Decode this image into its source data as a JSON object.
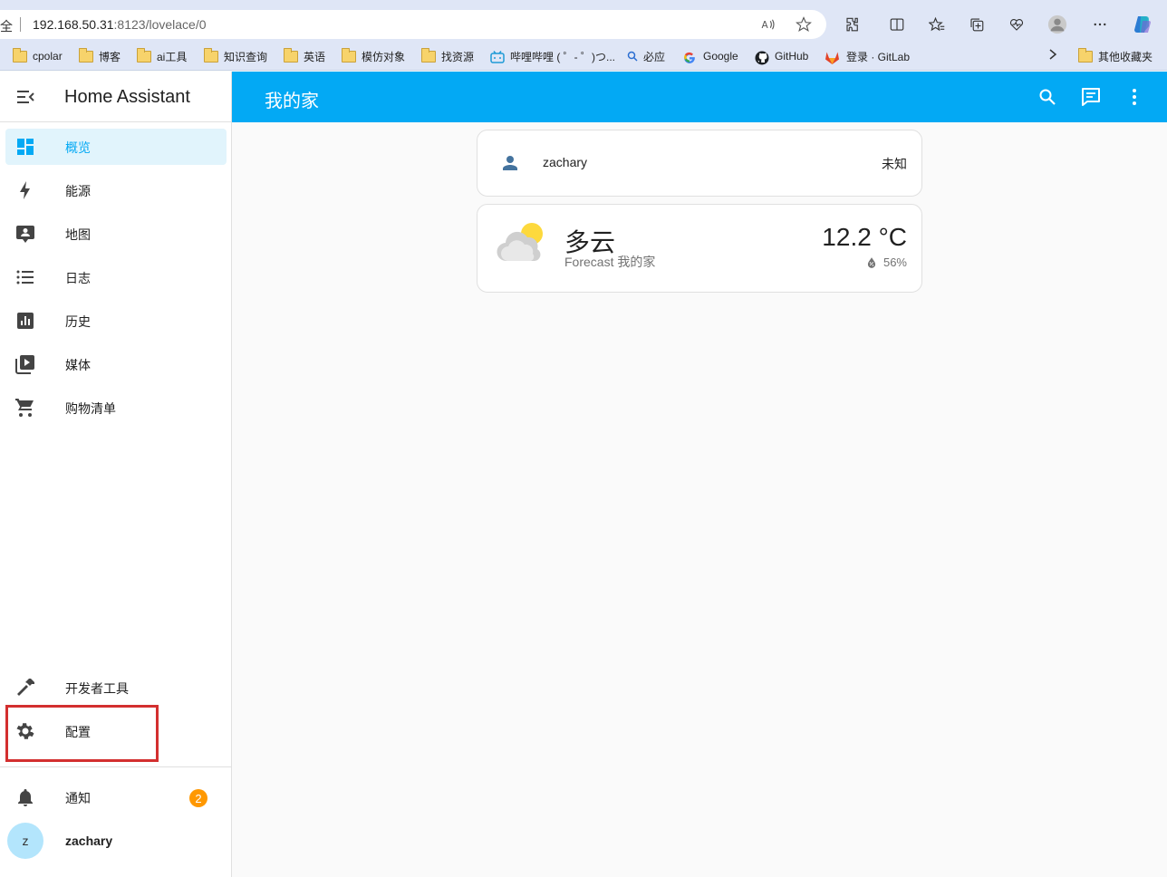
{
  "browser": {
    "address_prefix": "全",
    "url_host": "192.168.50.31",
    "url_path": ":8123/lovelace/0",
    "bookmarks": [
      {
        "label": "cpolar",
        "icon": "folder-icon"
      },
      {
        "label": "博客",
        "icon": "folder-icon"
      },
      {
        "label": "ai工具",
        "icon": "folder-icon"
      },
      {
        "label": "知识查询",
        "icon": "folder-icon"
      },
      {
        "label": "英语",
        "icon": "folder-icon"
      },
      {
        "label": "模仿对象",
        "icon": "folder-icon"
      },
      {
        "label": "找资源",
        "icon": "folder-icon"
      },
      {
        "label": "哔哩哔哩 ( ゜- ゜)つ...",
        "icon": "bilibili-icon"
      },
      {
        "label": "必应",
        "icon": "bing-search-icon"
      },
      {
        "label": "Google",
        "icon": "google-icon"
      },
      {
        "label": "GitHub",
        "icon": "github-icon"
      },
      {
        "label": "登录 · GitLab",
        "icon": "gitlab-icon"
      },
      {
        "label": "其他收藏夹",
        "icon": "folder-icon"
      }
    ]
  },
  "sidebar": {
    "title": "Home Assistant",
    "items": [
      {
        "label": "概览",
        "icon": "dashboard-icon"
      },
      {
        "label": "能源",
        "icon": "lightning-icon"
      },
      {
        "label": "地图",
        "icon": "map-account-icon"
      },
      {
        "label": "日志",
        "icon": "list-icon"
      },
      {
        "label": "历史",
        "icon": "chart-box-icon"
      },
      {
        "label": "媒体",
        "icon": "play-box-icon"
      },
      {
        "label": "购物清单",
        "icon": "cart-icon"
      }
    ],
    "bottom_items": [
      {
        "label": "开发者工具",
        "icon": "hammer-icon"
      },
      {
        "label": "配置",
        "icon": "gear-icon"
      }
    ],
    "notifications": {
      "label": "通知",
      "count": "2"
    },
    "user": {
      "name": "zachary",
      "initial": "z"
    }
  },
  "header": {
    "title": "我的家"
  },
  "cards": {
    "person": {
      "name": "zachary",
      "state": "未知"
    },
    "weather": {
      "condition": "多云",
      "name": "Forecast 我的家",
      "temperature": "12.2 °C",
      "humidity": "56%"
    }
  },
  "colors": {
    "accent": "#03a9f4",
    "active_bg": "#e1f4fc",
    "badge": "#ff9800",
    "highlight": "#d32f2f"
  }
}
